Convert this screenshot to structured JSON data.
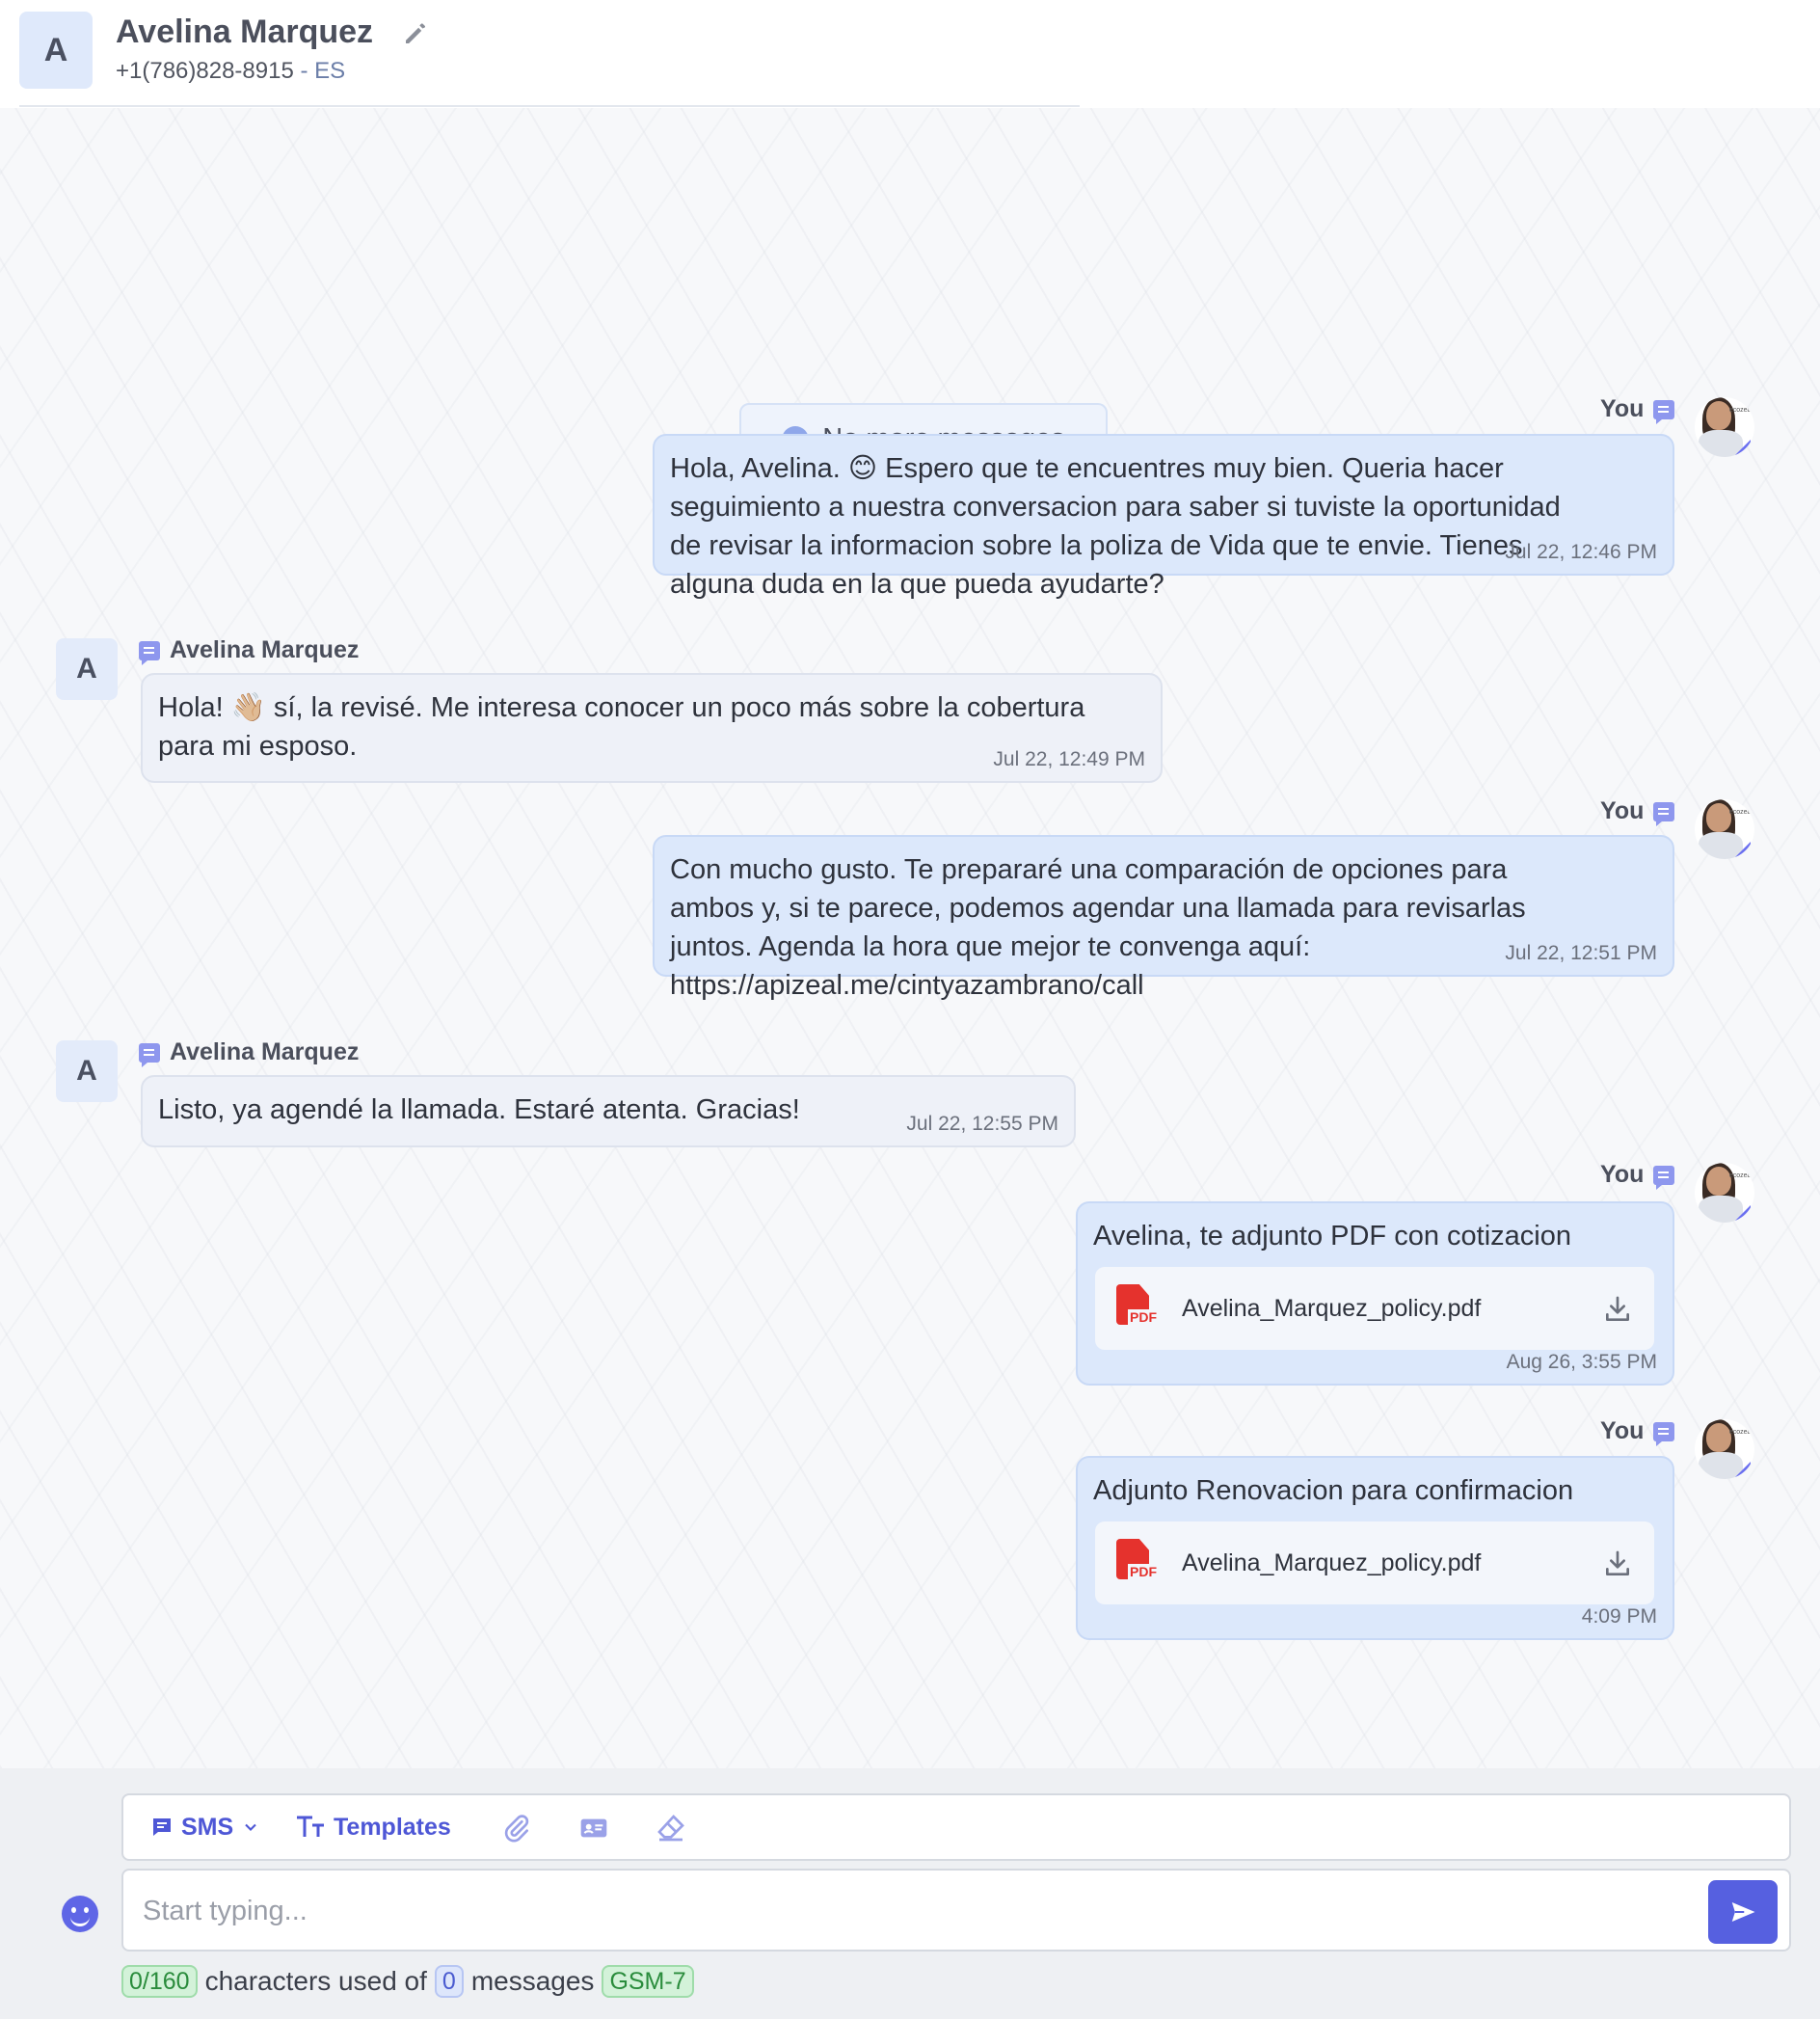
{
  "contact": {
    "initial": "A",
    "name": "Avelina Marquez",
    "phone": "+1(786)828-8915",
    "lang": " - ES"
  },
  "status": {
    "no_more": "No more messages"
  },
  "messages": [
    {
      "sender": "You",
      "text_lines": [
        "Hola, Avelina. 😊 Espero que te encuentres muy bien. Queria hacer",
        "seguimiento a nuestra conversacion para saber si tuviste la oportunidad",
        "de revisar la informacion sobre la poliza de Vida que te envie. Tienes",
        "alguna duda en la que pueda ayudarte?"
      ],
      "time": "Jul 22, 12:46 PM"
    },
    {
      "sender": "Avelina Marquez",
      "initial": "A",
      "text_lines": [
        "Hola! 👋🏼 sí, la revisé. Me interesa conocer un poco más sobre la cobertura",
        "para mi esposo."
      ],
      "time": "Jul 22, 12:49 PM"
    },
    {
      "sender": "You",
      "text_lines": [
        "Con mucho gusto. Te prepararé una comparación de opciones para",
        "ambos y, si te parece, podemos agendar una llamada para revisarlas",
        "juntos. Agenda la hora que mejor te convenga aquí:",
        "https://apizeal.me/cintyazambrano/call"
      ],
      "time": "Jul 22, 12:51 PM"
    },
    {
      "sender": "Avelina Marquez",
      "initial": "A",
      "text_lines": [
        "Listo, ya agendé la llamada. Estaré atenta. Gracias!"
      ],
      "time": "Jul 22, 12:55 PM"
    },
    {
      "sender": "You",
      "text_lines": [
        "Avelina, te adjunto PDF con cotizacion"
      ],
      "file": "Avelina_Marquez_policy.pdf",
      "time": "Aug 26, 3:55 PM"
    },
    {
      "sender": "You",
      "text_lines": [
        "Adjunto Renovacion para confirmacion"
      ],
      "file": "Avelina_Marquez_policy.pdf",
      "time": "4:09 PM"
    }
  ],
  "composer": {
    "channel": "SMS",
    "templates": "Templates",
    "placeholder": "Start typing...",
    "chars_used": "0/160",
    "text_chars": "characters used of",
    "msg_count": "0",
    "text_messages": "messages",
    "encoding": "GSM-7"
  },
  "colors": {
    "accent": "#5660e0",
    "outgoing_bubble": "#dce8fb",
    "incoming_bubble": "#eef1f8"
  },
  "icons": [
    "edit-icon",
    "check-circle-icon",
    "message-icon",
    "pdf-icon",
    "download-icon",
    "chat-icon",
    "chevron-down-icon",
    "text-format-icon",
    "paperclip-icon",
    "contact-card-icon",
    "eraser-icon",
    "send-icon",
    "emoji-icon"
  ]
}
